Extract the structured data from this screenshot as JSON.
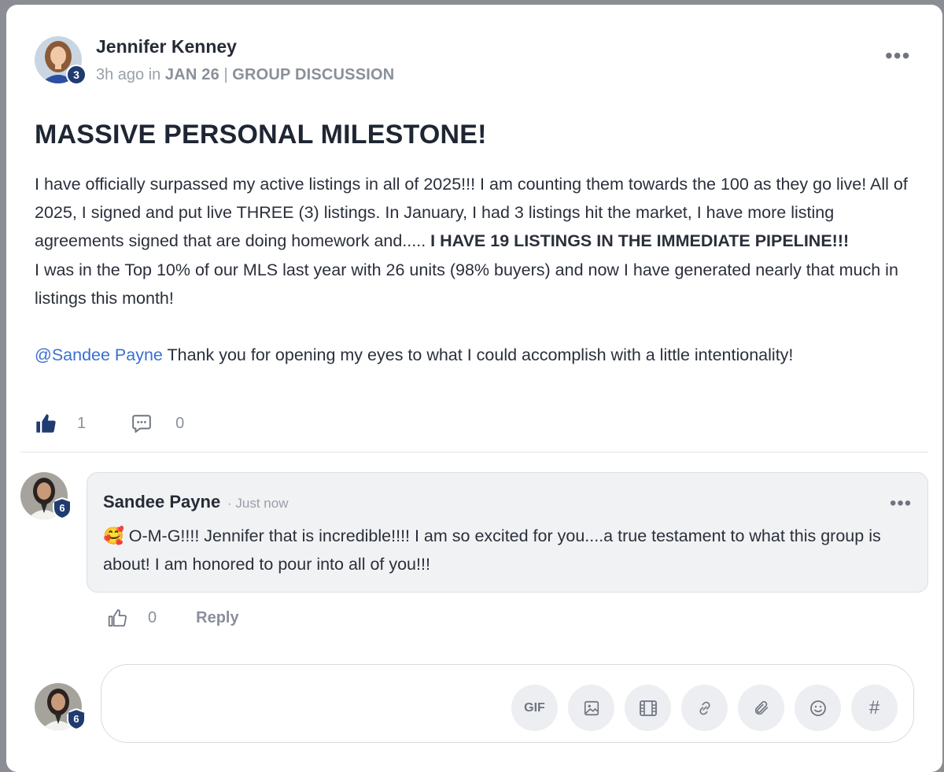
{
  "post": {
    "author": "Jennifer Kenney",
    "author_level": "3",
    "time_ago": "3h ago",
    "in_word": "in",
    "group": "JAN 26",
    "separator": "|",
    "category": "GROUP DISCUSSION",
    "title": "MASSIVE PERSONAL MILESTONE!",
    "body_part1": "I have officially surpassed my active listings in all of 2025!!! I am counting them towards the 100 as they go live! All of 2025, I signed and put live THREE (3) listings. In January, I had 3 listings hit the market, I have more listing agreements signed that are doing homework and..... ",
    "body_bold": "I HAVE 19 LISTINGS IN THE IMMEDIATE PIPELINE!!!",
    "body_part2": "I was in the Top 10% of our MLS last year with 26 units (98% buyers) and now I have generated nearly that much in listings this month!",
    "mention": "@Sandee Payne",
    "body_part3": " Thank you for opening my eyes to what I could accomplish with a little intentionality!",
    "likes": "1",
    "comments": "0",
    "more": "•••"
  },
  "comment": {
    "author": "Sandee Payne",
    "author_level": "6",
    "time": "· Just now",
    "emoji": "🥰",
    "text": " O-M-G!!!! Jennifer that is incredible!!!! I am so excited for you....a true testament to what this group is about! I am honored to pour into all of you!!!",
    "likes": "0",
    "reply_label": "Reply",
    "more": "•••"
  },
  "composer": {
    "user_level": "6",
    "gif_label": "GIF",
    "hash_label": "#"
  },
  "colors": {
    "accent": "#1f3b70",
    "mention": "#3a6fd0",
    "muted": "#8a909a"
  }
}
